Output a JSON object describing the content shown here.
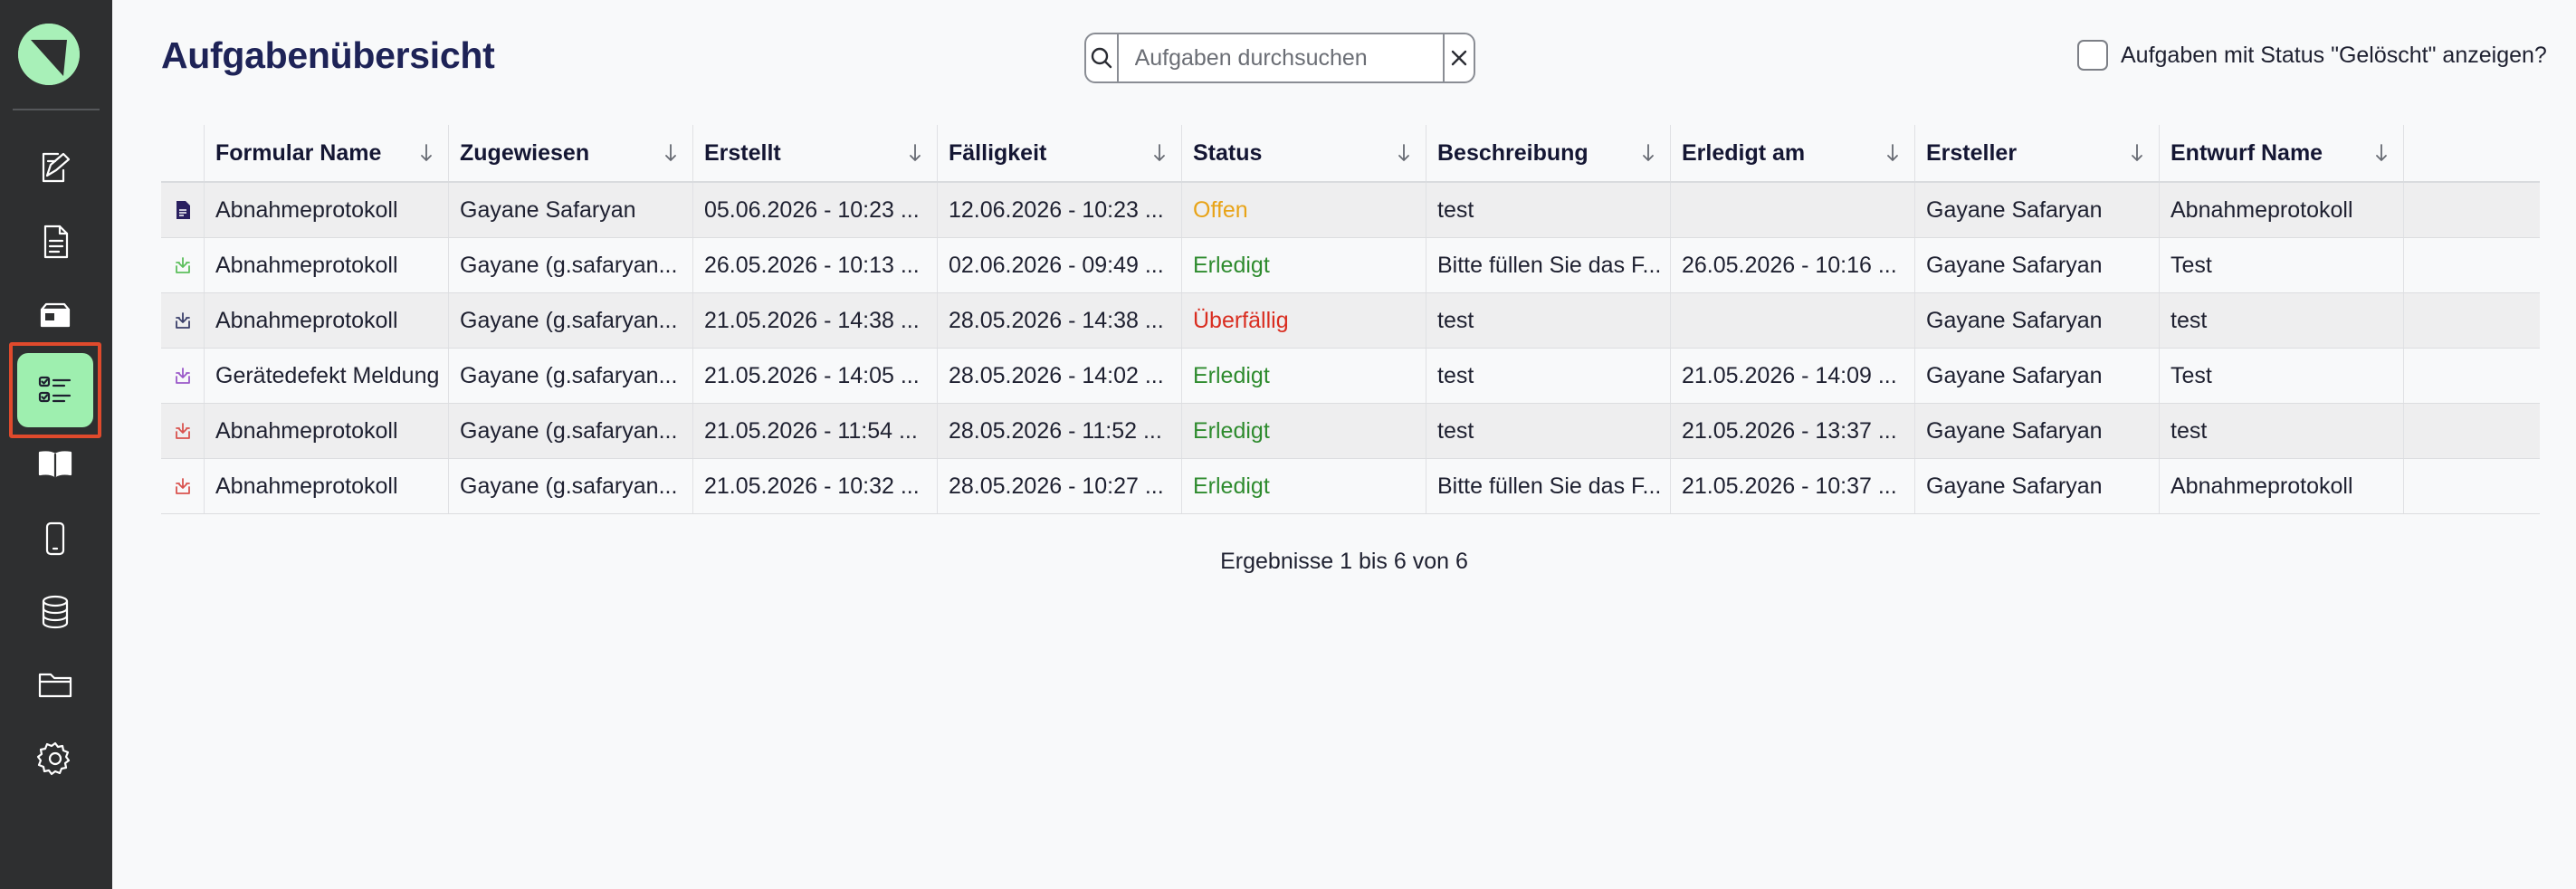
{
  "app": {
    "page_title": "Aufgabenübersicht"
  },
  "sidebar": {
    "items": [
      {
        "name": "form-editor",
        "icon": "form-edit-icon"
      },
      {
        "name": "documents",
        "icon": "document-icon"
      },
      {
        "name": "inbox",
        "icon": "inbox-icon"
      },
      {
        "name": "tasks",
        "icon": "task-list-icon",
        "active": true
      },
      {
        "name": "manual",
        "icon": "book-icon"
      },
      {
        "name": "devices",
        "icon": "smartphone-icon"
      },
      {
        "name": "database",
        "icon": "database-icon"
      },
      {
        "name": "files",
        "icon": "folder-icon"
      },
      {
        "name": "settings",
        "icon": "gear-icon"
      }
    ]
  },
  "search": {
    "placeholder": "Aufgaben durchsuchen",
    "value": ""
  },
  "deleted_toggle": {
    "label": "Aufgaben mit Status \"Gelöscht\" anzeigen?",
    "checked": false
  },
  "table": {
    "columns": [
      "Formular Name",
      "Zugewiesen",
      "Erstellt",
      "Fälligkeit",
      "Status",
      "Beschreibung",
      "Erledigt am",
      "Ersteller",
      "Entwurf Name"
    ],
    "rows": [
      {
        "icon_color": "#2a2060",
        "icon": "document-filled-icon",
        "formular": "Abnahmeprotokoll",
        "zugewiesen": "Gayane Safaryan",
        "erstellt": "05.06.2026 - 10:23 ...",
        "faelligkeit": "12.06.2026 - 10:23 ...",
        "status": "Offen",
        "status_class": "status-offen",
        "beschreibung": "test",
        "erledigt_am": "",
        "ersteller": "Gayane Safaryan",
        "entwurf": "Abnahmeprotokoll"
      },
      {
        "icon_color": "#5cbf5c",
        "icon": "tray-download-icon",
        "formular": "Abnahmeprotokoll",
        "zugewiesen": "Gayane (g.safaryan...",
        "erstellt": "26.05.2026 - 10:13 ...",
        "faelligkeit": "02.06.2026 - 09:49 ...",
        "status": "Erledigt",
        "status_class": "status-erledigt",
        "beschreibung": "Bitte füllen Sie das F...",
        "erledigt_am": "26.05.2026 - 10:16 ...",
        "ersteller": "Gayane Safaryan",
        "entwurf": "Test"
      },
      {
        "icon_color": "#3a3f6a",
        "icon": "tray-download-icon",
        "formular": "Abnahmeprotokoll",
        "zugewiesen": "Gayane (g.safaryan...",
        "erstellt": "21.05.2026 - 14:38 ...",
        "faelligkeit": "28.05.2026 - 14:38 ...",
        "status": "Überfällig",
        "status_class": "status-ueberfaellig",
        "beschreibung": "test",
        "erledigt_am": "",
        "ersteller": "Gayane Safaryan",
        "entwurf": "test"
      },
      {
        "icon_color": "#9b59c9",
        "icon": "tray-download-icon",
        "formular": "Gerätedefekt Meldung",
        "zugewiesen": "Gayane (g.safaryan...",
        "erstellt": "21.05.2026 - 14:05 ...",
        "faelligkeit": "28.05.2026 - 14:02 ...",
        "status": "Erledigt",
        "status_class": "status-erledigt",
        "beschreibung": "test",
        "erledigt_am": "21.05.2026 - 14:09 ...",
        "ersteller": "Gayane Safaryan",
        "entwurf": "Test"
      },
      {
        "icon_color": "#d9534f",
        "icon": "tray-download-icon",
        "formular": "Abnahmeprotokoll",
        "zugewiesen": "Gayane (g.safaryan...",
        "erstellt": "21.05.2026 - 11:54 ...",
        "faelligkeit": "28.05.2026 - 11:52 ...",
        "status": "Erledigt",
        "status_class": "status-erledigt",
        "beschreibung": "test",
        "erledigt_am": "21.05.2026 - 13:37 ...",
        "ersteller": "Gayane Safaryan",
        "entwurf": "test"
      },
      {
        "icon_color": "#d9534f",
        "icon": "tray-download-icon",
        "formular": "Abnahmeprotokoll",
        "zugewiesen": "Gayane (g.safaryan...",
        "erstellt": "21.05.2026 - 10:32 ...",
        "faelligkeit": "28.05.2026 - 10:27 ...",
        "status": "Erledigt",
        "status_class": "status-erledigt",
        "beschreibung": "Bitte füllen Sie das F...",
        "erledigt_am": "21.05.2026 - 10:37 ...",
        "ersteller": "Gayane Safaryan",
        "entwurf": "Abnahmeprotokoll"
      }
    ]
  },
  "pagination": {
    "summary": "Ergebnisse 1 bis 6 von 6"
  },
  "colors": {
    "sidebar_bg": "#2e2f30",
    "accent_green": "#9eefaf",
    "active_outline": "#e04a2c",
    "title": "#1e2357"
  }
}
